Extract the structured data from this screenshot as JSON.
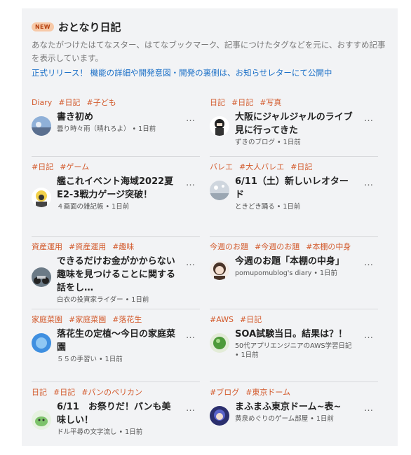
{
  "header": {
    "badge": "NEW",
    "title": "おとなり日記",
    "description": "あなたがつけたはてなスター、はてなブックマーク、記事につけたタグなどを元に、おすすめ記事を表示しています。",
    "notice": "正式リリース！ 機能の詳細や開発意図・開発の裏側は、お知らせレターにて公開中"
  },
  "entries": [
    {
      "tags": [
        "Diary",
        "#日記",
        "#子ども"
      ],
      "title": "書き初め",
      "blog": "曇り時々雨（晴れろよ）",
      "time": "1日前"
    },
    {
      "tags": [
        "日記",
        "#日記",
        "#写真"
      ],
      "title": "大阪にジャルジャルのライブ見に行ってきた",
      "blog": "ずきのブログ",
      "time": "1日前"
    },
    {
      "tags": [
        "#日記",
        "#ゲーム"
      ],
      "title": "艦これイベント海域2022夏　E2-3戦力ゲージ突破！",
      "blog": "４画面の雑記帳",
      "time": "1日前"
    },
    {
      "tags": [
        "バレエ",
        "#大人バレエ",
        "#日記"
      ],
      "title": "6/11（土）新しいレオタード",
      "blog": "ときどき踊る",
      "time": "1日前"
    },
    {
      "tags": [
        "資産運用",
        "#資産運用",
        "#趣味"
      ],
      "title": "できるだけお金がかからない趣味を見つけることに関する話をし…",
      "blog": "白衣の投資家ライダー",
      "time": "1日前"
    },
    {
      "tags": [
        "今週のお題",
        "#今週のお題",
        "#本棚の中身"
      ],
      "title": "今週のお題「本棚の中身」",
      "blog": "pomupomublog's diary",
      "time": "1日前"
    },
    {
      "tags": [
        "家庭菜園",
        "#家庭菜園",
        "#落花生"
      ],
      "title": "落花生の定植〜今日の家庭菜園",
      "blog": "５５の手習い",
      "time": "1日前"
    },
    {
      "tags": [
        "#AWS",
        "#日記"
      ],
      "title": "SOA試験当日。結果は？！",
      "blog": "50代アプリエンジニアのAWS学習日記",
      "time": "1日前"
    },
    {
      "tags": [
        "日記",
        "#日記",
        "#パンのペリカン"
      ],
      "title": "6/11　お祭りだ！パンも美味しい！",
      "blog": "ドル平尋の文字流し",
      "time": "1日前"
    },
    {
      "tags": [
        "#ブログ",
        "#東京ドーム"
      ],
      "title": "まふまふ東京ドーム~表~",
      "blog": "黄泉めぐりのゲーム部屋",
      "time": "1日前"
    }
  ],
  "more_label": "…",
  "colors": {
    "tag": "#d35a2c",
    "link": "#1a6fc7",
    "panel": "#f2f3f5"
  }
}
